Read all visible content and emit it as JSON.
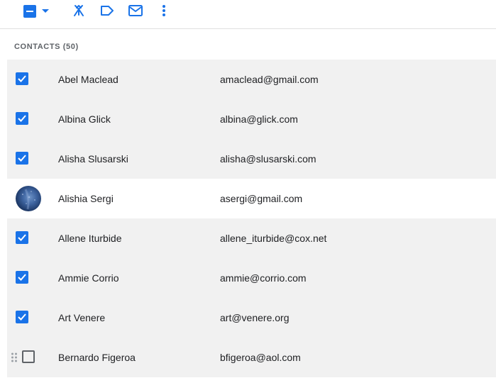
{
  "toolbar": {
    "icons": [
      "select-all-checkbox-icon",
      "dropdown-arrow-icon",
      "merge-icon",
      "label-icon",
      "email-icon",
      "more-vert-icon"
    ],
    "accent_color": "#1a73e8"
  },
  "section": {
    "title": "CONTACTS",
    "count": "(50)"
  },
  "contacts": [
    {
      "name": "Abel Maclead",
      "email": "amaclead@gmail.com",
      "selected": true
    },
    {
      "name": "Albina Glick",
      "email": "albina@glick.com",
      "selected": true
    },
    {
      "name": "Alisha Slusarski",
      "email": "alisha@slusarski.com",
      "selected": true
    },
    {
      "name": "Alishia Sergi",
      "email": "asergi@gmail.com",
      "selected": false,
      "avatar": true
    },
    {
      "name": "Allene Iturbide",
      "email": "allene_iturbide@cox.net",
      "selected": true
    },
    {
      "name": "Ammie Corrio",
      "email": "ammie@corrio.com",
      "selected": true
    },
    {
      "name": "Art Venere",
      "email": "art@venere.org",
      "selected": true
    },
    {
      "name": "Bernardo Figeroa",
      "email": "bfigeroa@aol.com",
      "selected": false,
      "hovered": true
    }
  ]
}
